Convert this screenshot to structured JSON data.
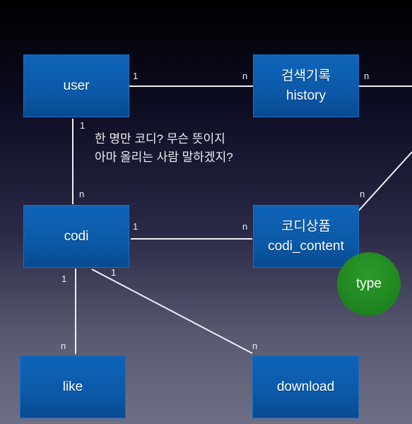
{
  "entities": {
    "user": {
      "label": "user"
    },
    "history": {
      "label_ko": "검색기록",
      "label": "history"
    },
    "codi": {
      "label": "codi"
    },
    "codi_content": {
      "label_ko": "코디상품",
      "label": "codi_content"
    },
    "like": {
      "label": "like"
    },
    "download": {
      "label": "download"
    },
    "type": {
      "label": "type"
    }
  },
  "cardinalities": {
    "user_history_1": "1",
    "user_history_n": "n",
    "history_right_n": "n",
    "user_codi_1": "1",
    "user_codi_n": "n",
    "codi_content_1": "1",
    "codi_content_n": "n",
    "content_diag_n": "n",
    "codi_like_1": "1",
    "codi_download_1": "1",
    "like_n": "n",
    "download_n": "n"
  },
  "note": {
    "line1": "한 명만 코디? 무슨 뜻이지",
    "line2": "아마 올리는 사람 말하겠지?"
  },
  "colors": {
    "entity": "#0b59a8",
    "attribute": "#1f8a1f",
    "line": "#ffffff"
  }
}
